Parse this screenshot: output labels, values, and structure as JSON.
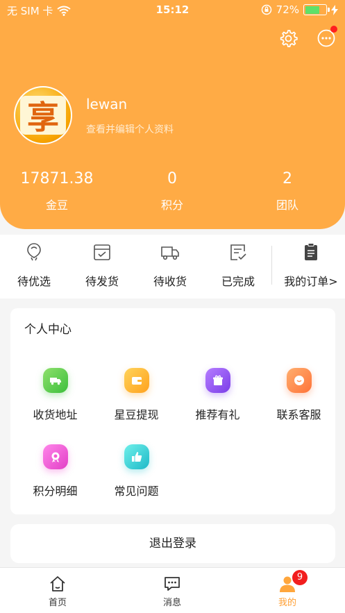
{
  "status_bar": {
    "carrier": "无 SIM 卡",
    "time": "15:12",
    "battery_percent": "72%",
    "battery_level": 0.72
  },
  "header": {
    "bg_color": "#ffab45",
    "avatar_char": "享",
    "username": "lewan",
    "edit_profile": "查看并编辑个人资料",
    "has_unread_messages": true
  },
  "stats": [
    {
      "value": "17871.38",
      "label": "金豆"
    },
    {
      "value": "0",
      "label": "积分"
    },
    {
      "value": "2",
      "label": "团队"
    }
  ],
  "orders": [
    {
      "label": "待优选",
      "icon": "balloon-icon"
    },
    {
      "label": "待发货",
      "icon": "package-icon"
    },
    {
      "label": "待收货",
      "icon": "delivery-truck-icon"
    },
    {
      "label": "已完成",
      "icon": "completed-list-icon"
    },
    {
      "label": "我的订单>",
      "icon": "clipboard-icon"
    }
  ],
  "center": {
    "title": "个人中心",
    "items": [
      {
        "label": "收货地址",
        "icon": "delivery-van-icon",
        "color": "#5ecb4a"
      },
      {
        "label": "星豆提现",
        "icon": "wallet-icon",
        "color": "#ffb52e"
      },
      {
        "label": "推荐有礼",
        "icon": "gift-icon",
        "color": "#9a5cf5"
      },
      {
        "label": "联系客服",
        "icon": "chat-bubble-icon",
        "color": "#ff8c4a"
      },
      {
        "label": "积分明细",
        "icon": "award-medal-icon",
        "color": "#f25ad4"
      },
      {
        "label": "常见问题",
        "icon": "thumbs-up-icon",
        "color": "#3fd3d8"
      }
    ]
  },
  "logout_label": "退出登录",
  "tabs": [
    {
      "label": "首页",
      "icon": "home-icon"
    },
    {
      "label": "消息",
      "icon": "message-icon"
    },
    {
      "label": "我的",
      "icon": "profile-icon",
      "badge": "9"
    }
  ],
  "accent_color": "#ff9f34"
}
